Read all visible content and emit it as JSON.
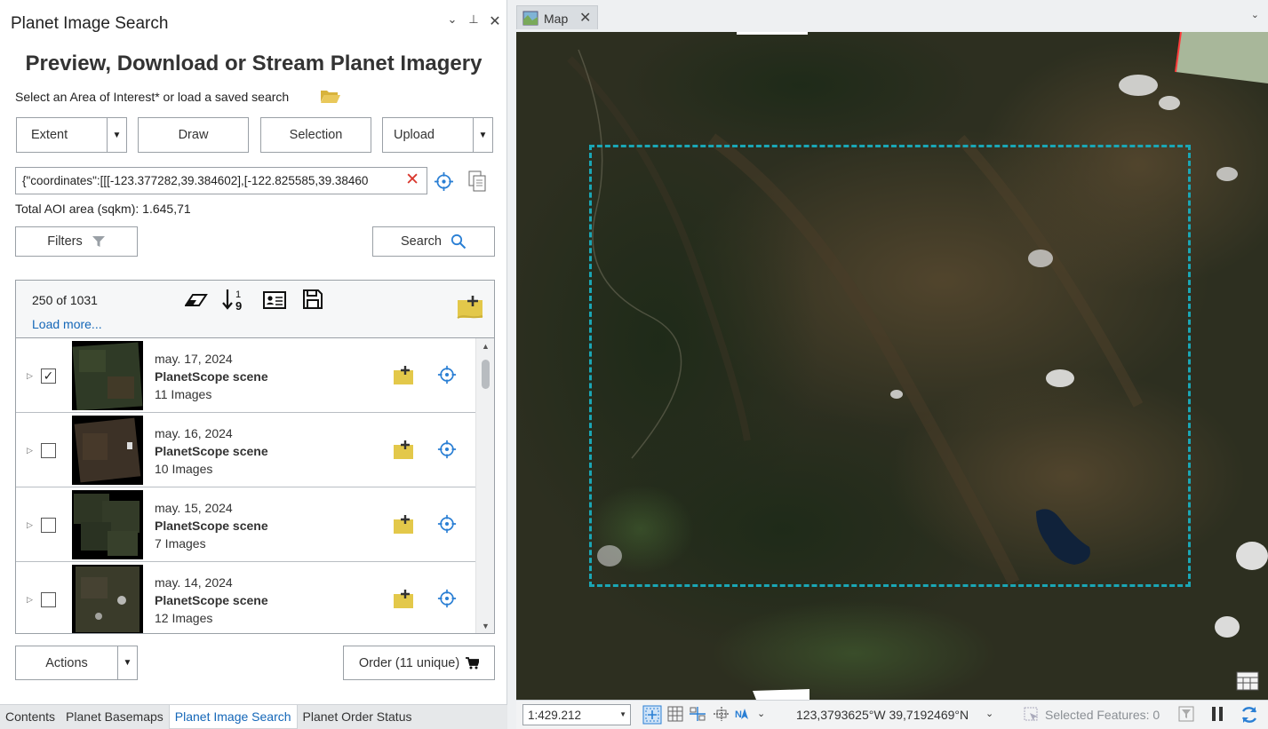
{
  "pane": {
    "title": "Planet Image Search",
    "heading": "Preview, Download or Stream Planet Imagery",
    "aoi_prompt": "Select an Area of Interest* or load a saved search",
    "aoi_buttons": {
      "extent": "Extent",
      "draw": "Draw",
      "selection": "Selection",
      "upload": "Upload"
    },
    "coordinates_value": "{\"coordinates\":[[[-123.377282,39.384602],[-122.825585,39.38460",
    "total_aoi": "Total AOI area (sqkm): 1.645,71",
    "filters_label": "Filters",
    "search_label": "Search",
    "results": {
      "count": "250 of 1031",
      "load_more": "Load more...",
      "items": [
        {
          "date": "may. 17, 2024",
          "type": "PlanetScope scene",
          "images": "11 Images",
          "checked": true
        },
        {
          "date": "may. 16, 2024",
          "type": "PlanetScope scene",
          "images": "10 Images",
          "checked": false
        },
        {
          "date": "may. 15, 2024",
          "type": "PlanetScope scene",
          "images": "7 Images",
          "checked": false
        },
        {
          "date": "may. 14, 2024",
          "type": "PlanetScope scene",
          "images": "12 Images",
          "checked": false
        }
      ]
    },
    "actions_label": "Actions",
    "order_label": "Order (11 unique)"
  },
  "bottom_tabs": [
    "Contents",
    "Planet Basemaps",
    "Planet Image Search",
    "Planet Order Status"
  ],
  "map": {
    "tab_label": "Map",
    "scale": "1:429.212",
    "coordinates": "123,3793625°W 39,7192469°N",
    "selected_features": "Selected Features: 0"
  },
  "colors": {
    "accent": "#1467b8",
    "aoi_outline": "#1aa6b5",
    "clear": "#d9382e",
    "add_icon": "#e3c84a"
  }
}
